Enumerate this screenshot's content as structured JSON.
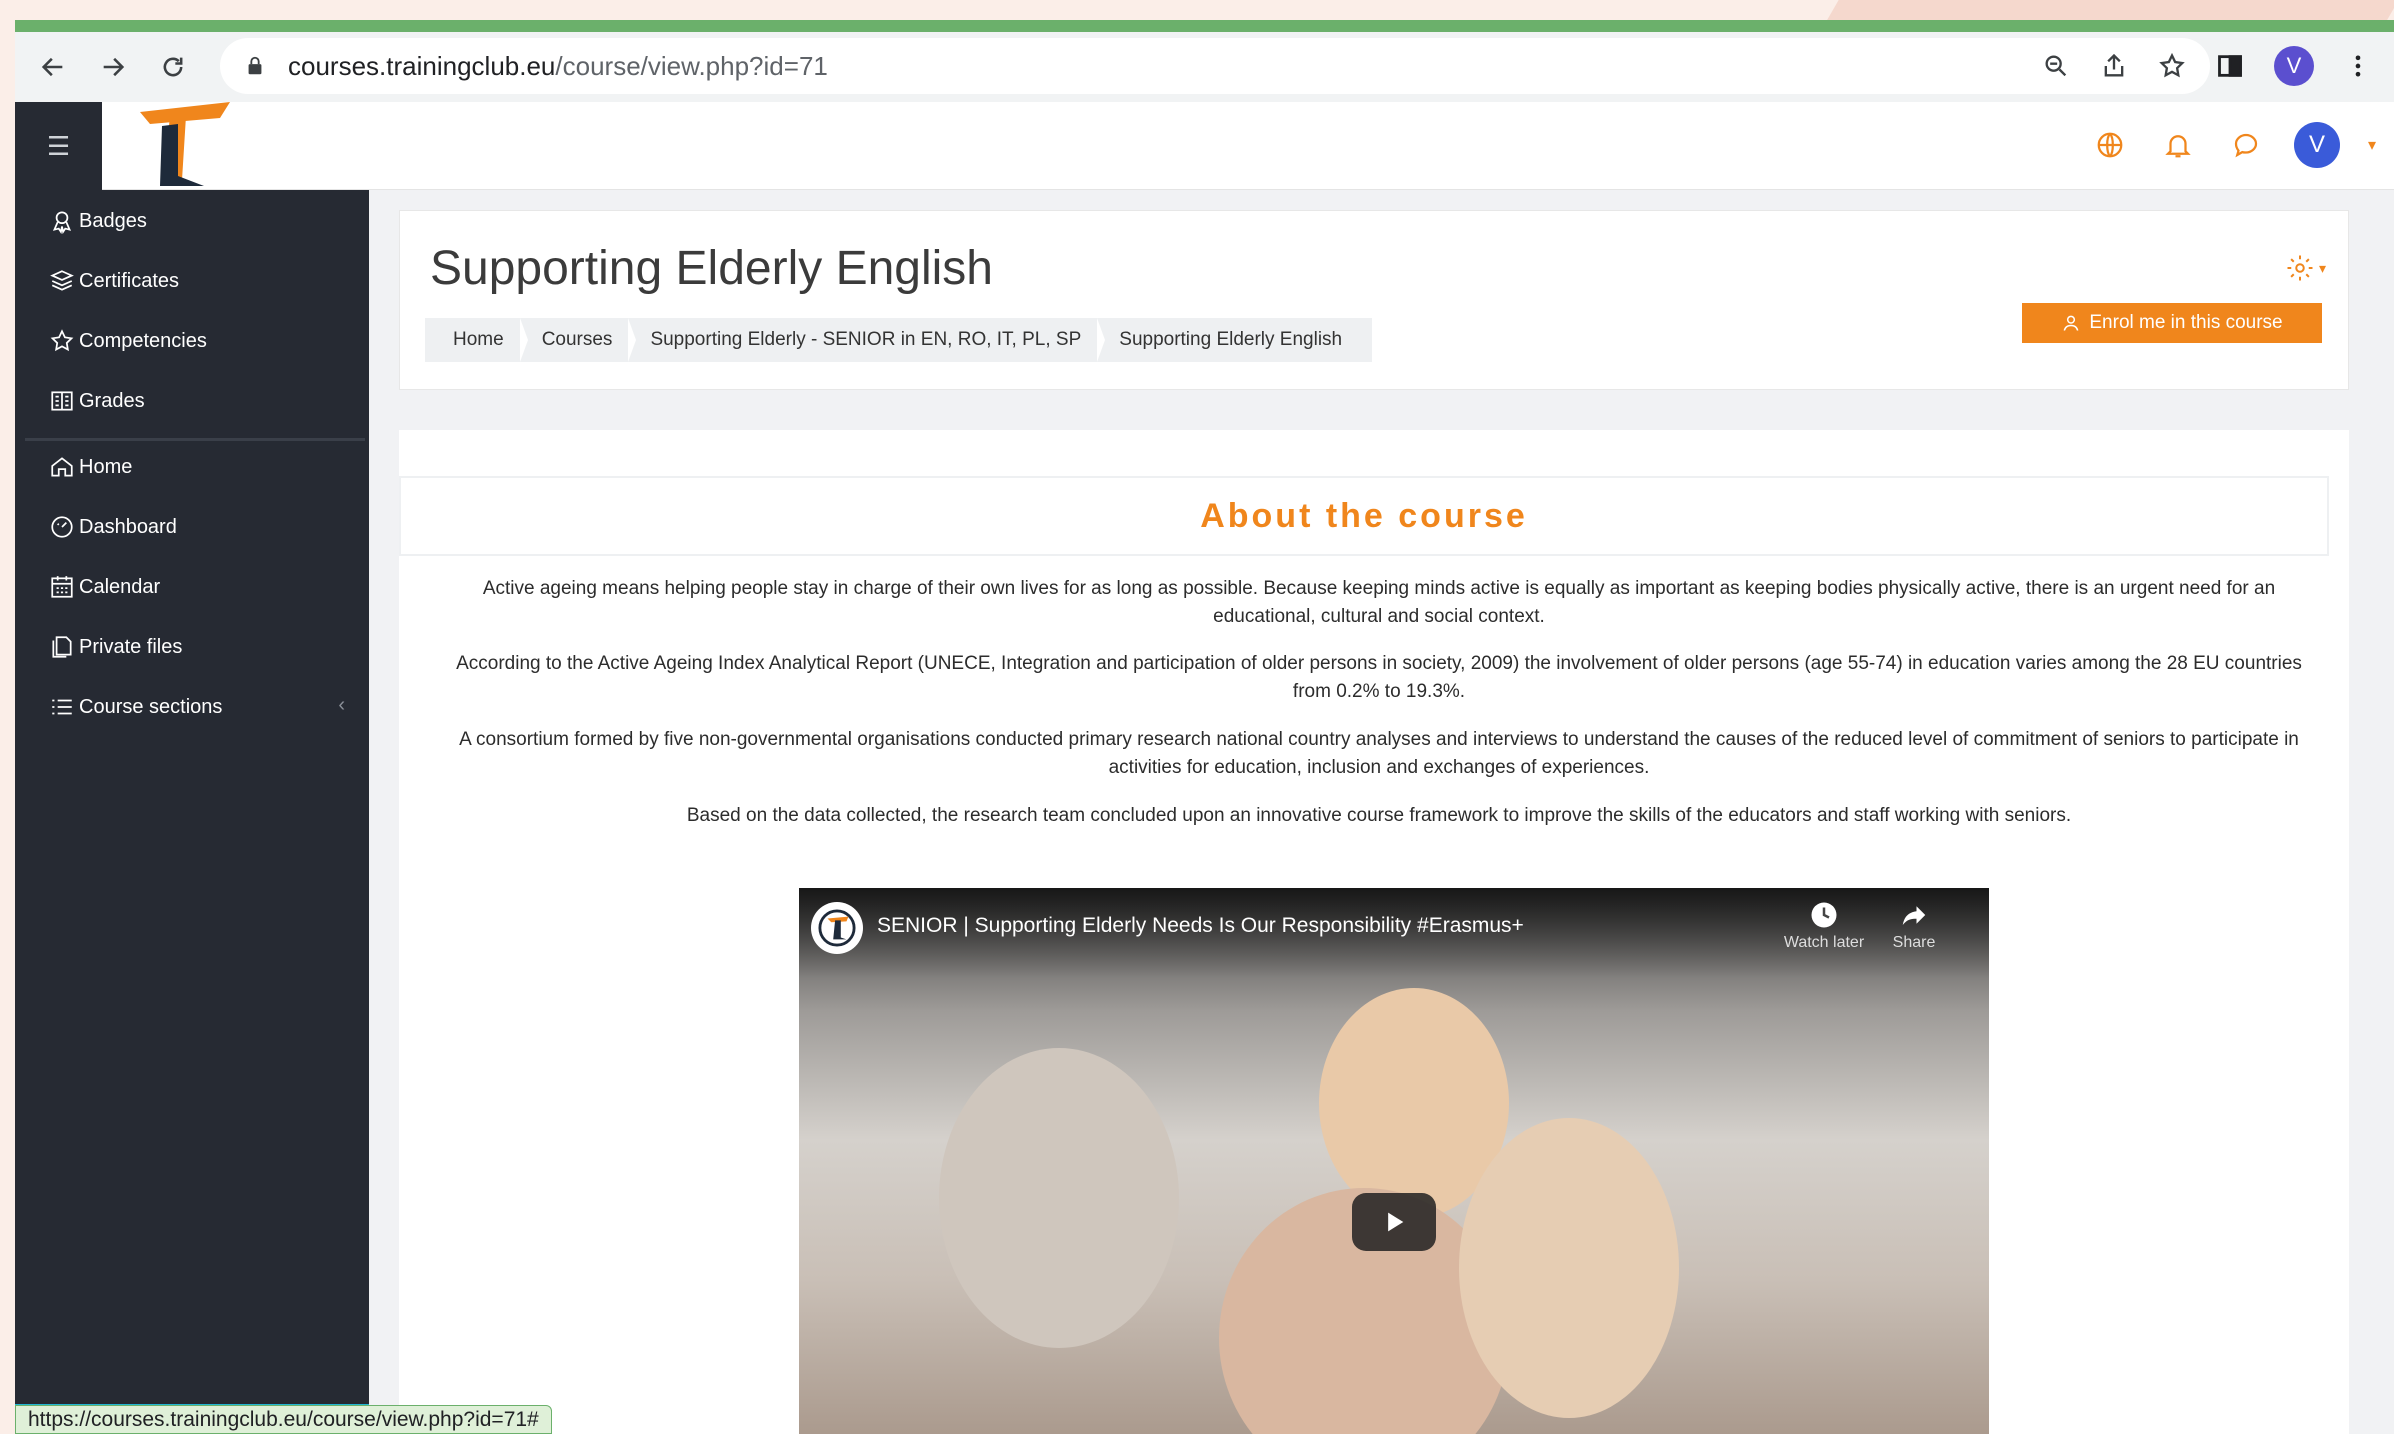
{
  "browser": {
    "url_host": "courses.trainingclub.eu",
    "url_path": "/course/view.php?id=71",
    "profile_initial": "V"
  },
  "navbar": {
    "user_initial": "V"
  },
  "sidebar": {
    "items": [
      {
        "label": "Badges",
        "icon": "badge-icon"
      },
      {
        "label": "Certificates",
        "icon": "certificate-icon"
      },
      {
        "label": "Competencies",
        "icon": "star-icon"
      },
      {
        "label": "Grades",
        "icon": "grades-icon"
      },
      {
        "label": "Home",
        "icon": "home-icon"
      },
      {
        "label": "Dashboard",
        "icon": "dashboard-icon"
      },
      {
        "label": "Calendar",
        "icon": "calendar-icon"
      },
      {
        "label": "Private files",
        "icon": "files-icon"
      },
      {
        "label": "Course sections",
        "icon": "list-icon"
      }
    ]
  },
  "header": {
    "title": "Supporting Elderly English",
    "breadcrumb": [
      "Home",
      "Courses",
      "Supporting Elderly - SENIOR in EN, RO, IT, PL, SP",
      "Supporting Elderly English"
    ],
    "enrol_label": "Enrol me in this course"
  },
  "main": {
    "about_title": "About the course",
    "paragraphs": [
      "Active ageing means helping people stay in charge of their own lives for as long as possible. Because keeping minds active is equally as important as keeping bodies physically active, there is an urgent need for an educational, cultural and social context.",
      "According to the Active Ageing Index Analytical Report (UNECE, Integration and participation of older persons in society, 2009) the involvement of older persons (age 55-74) in education varies among the 28 EU countries from 0.2% to 19.3%.",
      "A consortium formed by five non-governmental organisations conducted primary research national country analyses and interviews to understand the causes of the reduced level of commitment of seniors to participate in activities for education, inclusion and exchanges of experiences.",
      "Based on the data collected, the research team concluded upon an innovative course framework to improve the skills of the educators and staff working with seniors."
    ],
    "video": {
      "title": "SENIOR | Supporting Elderly Needs Is Our Responsibility #Erasmus+",
      "watch_later": "Watch later",
      "share": "Share"
    }
  },
  "status_bar": {
    "url": "https://courses.trainingclub.eu/course/view.php?id=71#"
  },
  "colors": {
    "accent": "#f0861c",
    "sidebar_bg": "#262a33"
  }
}
